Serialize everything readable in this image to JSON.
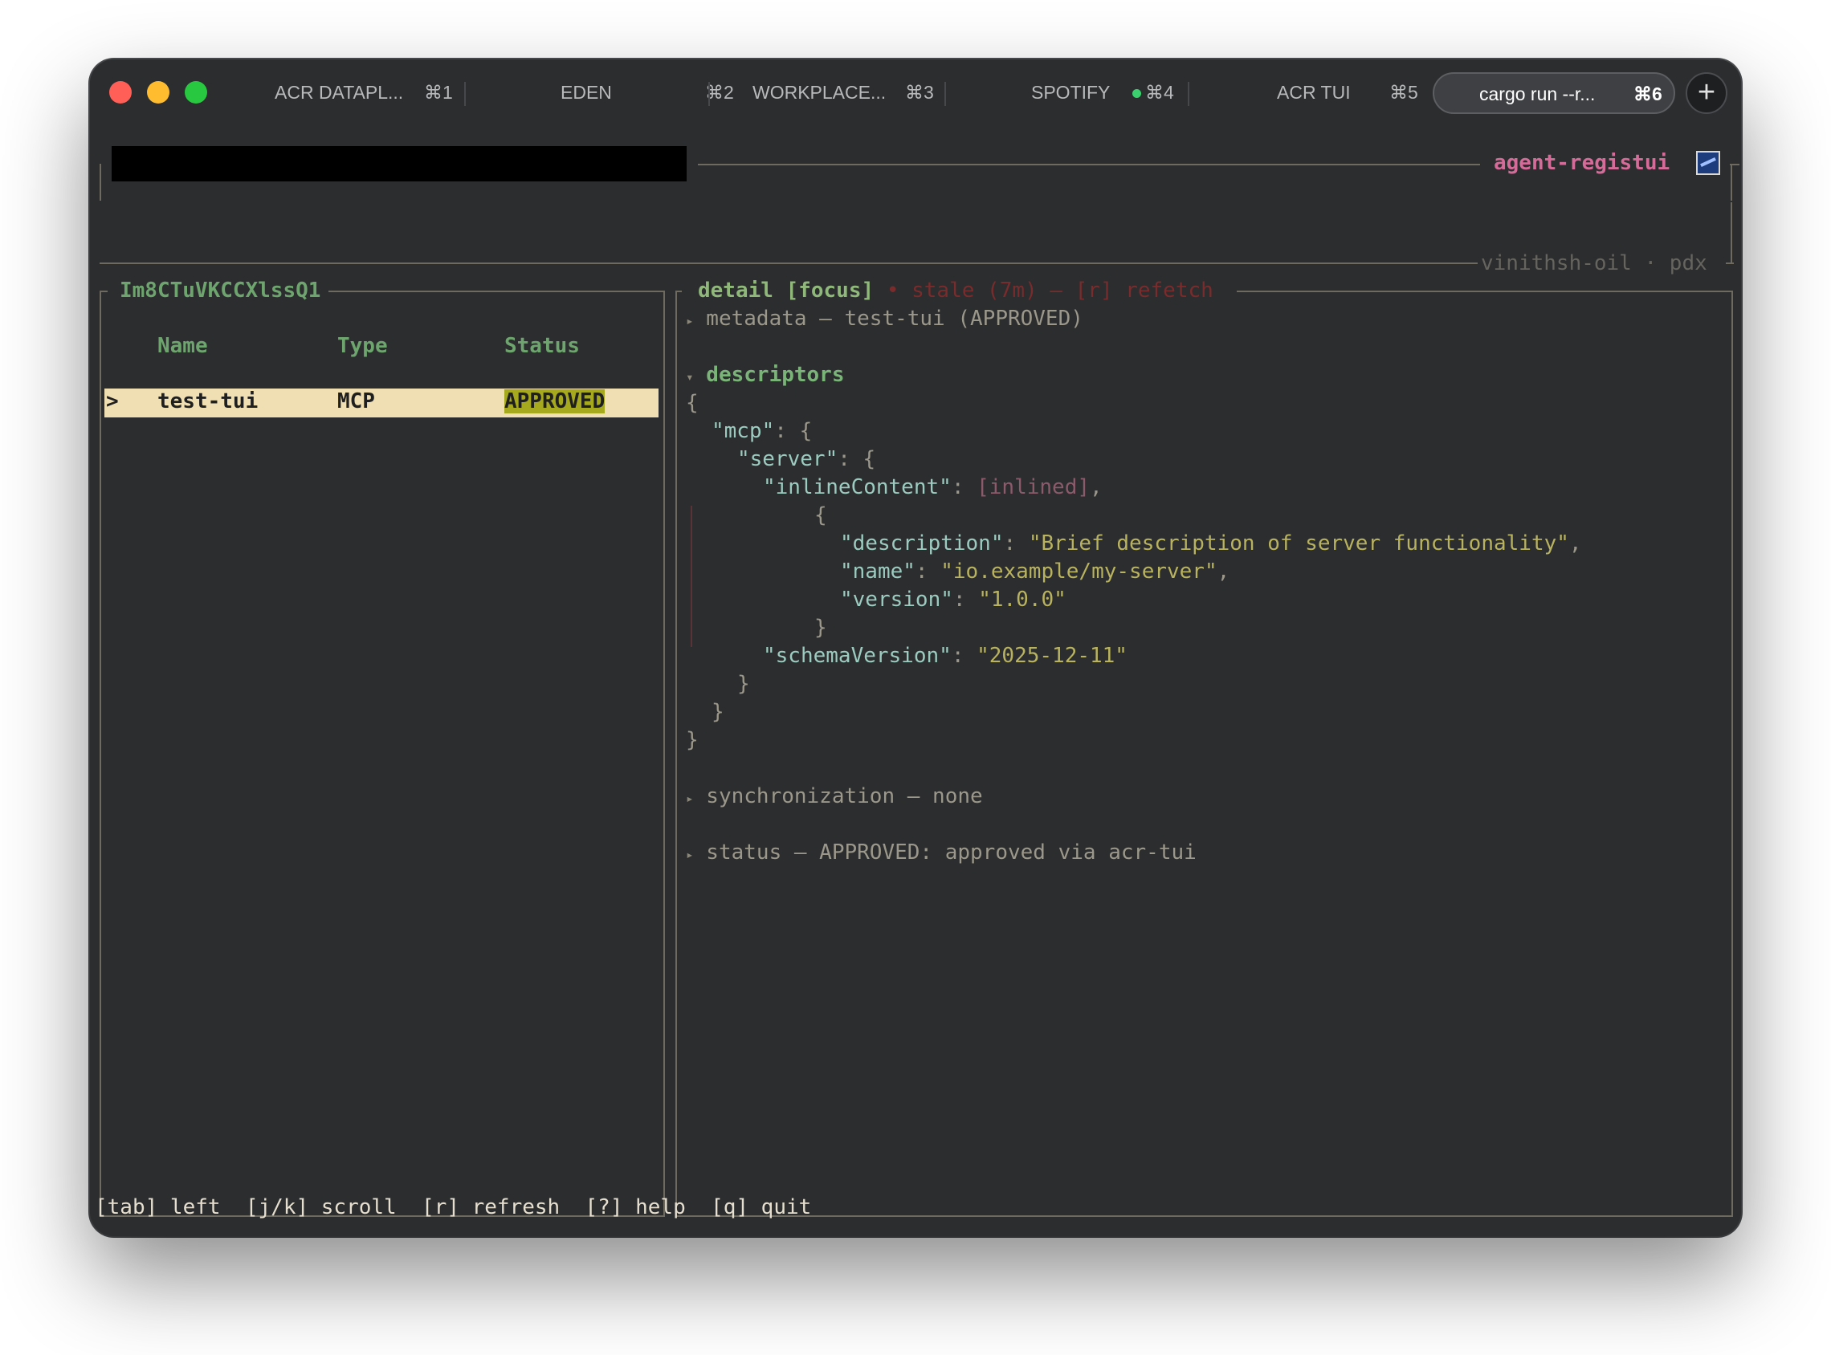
{
  "tabs": [
    {
      "title": "ACR DATAPL...",
      "key": "⌘1",
      "active": false,
      "dot": false
    },
    {
      "title": "EDEN",
      "key": "⌘2",
      "active": false,
      "dot": false
    },
    {
      "title": "WORKPLACE...",
      "key": "⌘3",
      "active": false,
      "dot": false
    },
    {
      "title": "SPOTIFY",
      "key": "⌘4",
      "active": false,
      "dot": true
    },
    {
      "title": "ACR TUI",
      "key": "⌘5",
      "active": false,
      "dot": false
    },
    {
      "title": "cargo run --r...",
      "key": "⌘6",
      "active": true,
      "dot": false
    }
  ],
  "new_tab_label": "+",
  "header": {
    "app_name": "agent-registui",
    "account": "vinithsh-oil · pdx"
  },
  "left_panel": {
    "title": "Im8CTuVKCCXlssQ1",
    "columns": [
      "Name",
      "Type",
      "Status"
    ],
    "rows": [
      {
        "cursor": ">",
        "name": "test-tui",
        "type": "MCP",
        "status": "APPROVED",
        "selected": true
      }
    ]
  },
  "detail": {
    "title": "detail [focus]",
    "stale": "• stale (7m) — [r] refetch",
    "metadata_line": "metadata — test-tui (APPROVED)",
    "descriptors_label": "descriptors",
    "json": {
      "open_brace": "{",
      "mcp_key": "\"mcp\"",
      "server_key": "\"server\"",
      "inline_key": "\"inlineContent\"",
      "inline_value": "[inlined]",
      "inner_open": "{",
      "description_key": "\"description\"",
      "description_value": "\"Brief description of server functionality\"",
      "name_key": "\"name\"",
      "name_value": "\"io.example/my-server\"",
      "version_key": "\"version\"",
      "version_value": "\"1.0.0\"",
      "inner_close": "}",
      "schema_key": "\"schemaVersion\"",
      "schema_value": "\"2025-12-11\"",
      "close_server": "}",
      "close_mcp": "}",
      "close_root": "}"
    },
    "synchronization_line": "synchronization — none",
    "status_line": "status — APPROVED: approved via acr-tui"
  },
  "footer": {
    "hints": [
      "[tab] left",
      "[j/k] scroll",
      "[r] refresh",
      "[?] help",
      "[q] quit"
    ]
  },
  "colors": {
    "background": "#2b2d2f",
    "border": "#6e6a5f",
    "accent_green": "#7bb478",
    "app_name_pink": "#d56b98",
    "selection_bg": "#efdfb2",
    "status_badge": "#a6a81e",
    "stale_red": "#7a2b2b"
  }
}
